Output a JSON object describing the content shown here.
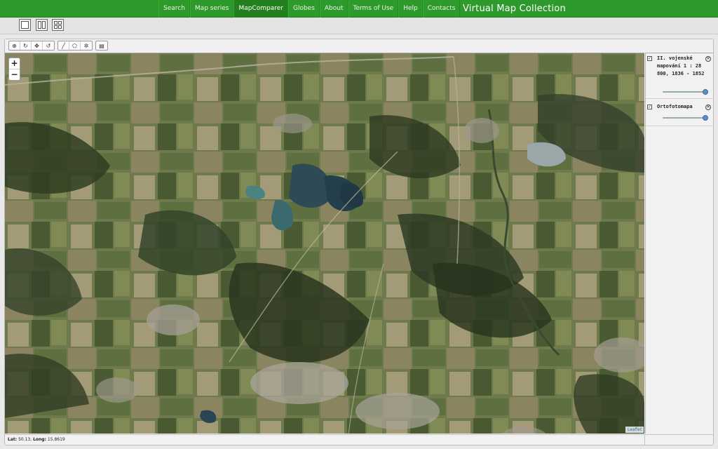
{
  "nav": {
    "items": [
      {
        "label": "Search",
        "active": false
      },
      {
        "label": "Map series",
        "active": false
      },
      {
        "label": "MapComparer",
        "active": true
      },
      {
        "label": "Globes",
        "active": false
      },
      {
        "label": "About",
        "active": false
      },
      {
        "label": "Terms of Use",
        "active": false
      },
      {
        "label": "Help",
        "active": false
      },
      {
        "label": "Contacts",
        "active": false
      }
    ],
    "brand": "Virtual Map Collection"
  },
  "layout_buttons": [
    "single-view-icon",
    "double-view-icon",
    "quad-view-icon"
  ],
  "map_tools": {
    "group1": [
      "zoom-in-tool-icon",
      "rotate-tool-icon",
      "pan-tool-icon",
      "reset-tool-icon"
    ],
    "group2": [
      "line-tool-icon",
      "polygon-tool-icon",
      "gear-icon"
    ],
    "group3": [
      "table-icon"
    ]
  },
  "zoom": {
    "plus": "+",
    "minus": "−"
  },
  "attribution": "Leaflet",
  "layers": [
    {
      "name": "II. vojenské mapování 1 : 28 800, 1836 - 1852",
      "checked": true,
      "opacity": 1.0
    },
    {
      "name": "Ortofotomapa",
      "checked": true,
      "opacity": 1.0
    }
  ],
  "status": {
    "lat_label": "Lat:",
    "lat_value": "50.13",
    "long_label": "Long:",
    "long_value": "15.8619"
  },
  "colors": {
    "nav_green": "#2f9a2c",
    "nav_active": "#24801f",
    "slider_knob": "#5d8fc2"
  }
}
